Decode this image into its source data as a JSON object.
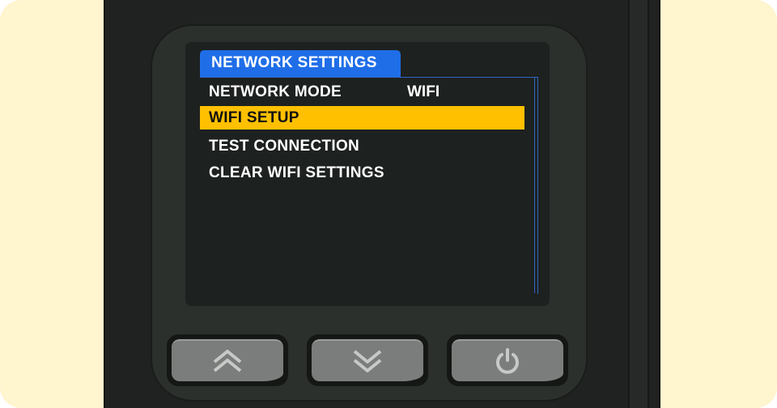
{
  "screen": {
    "title": "NETWORK SETTINGS",
    "menu": [
      {
        "label": "NETWORK MODE",
        "value": "WIFI",
        "selected": false
      },
      {
        "label": "WIFI SETUP",
        "value": "",
        "selected": true
      },
      {
        "label": "TEST CONNECTION",
        "value": "",
        "selected": false
      },
      {
        "label": "CLEAR WIFI SETTINGS",
        "value": "",
        "selected": false
      }
    ]
  },
  "buttons": [
    {
      "name": "up-button",
      "icon": "double-chevron-up-icon"
    },
    {
      "name": "down-button",
      "icon": "double-chevron-down-icon"
    },
    {
      "name": "power-button",
      "icon": "power-icon"
    }
  ],
  "colors": {
    "background": "#fff5cf",
    "device": "#1f2220",
    "title_tab": "#1f6ee8",
    "highlight": "#ffc000",
    "button": "#7a7d7b"
  }
}
